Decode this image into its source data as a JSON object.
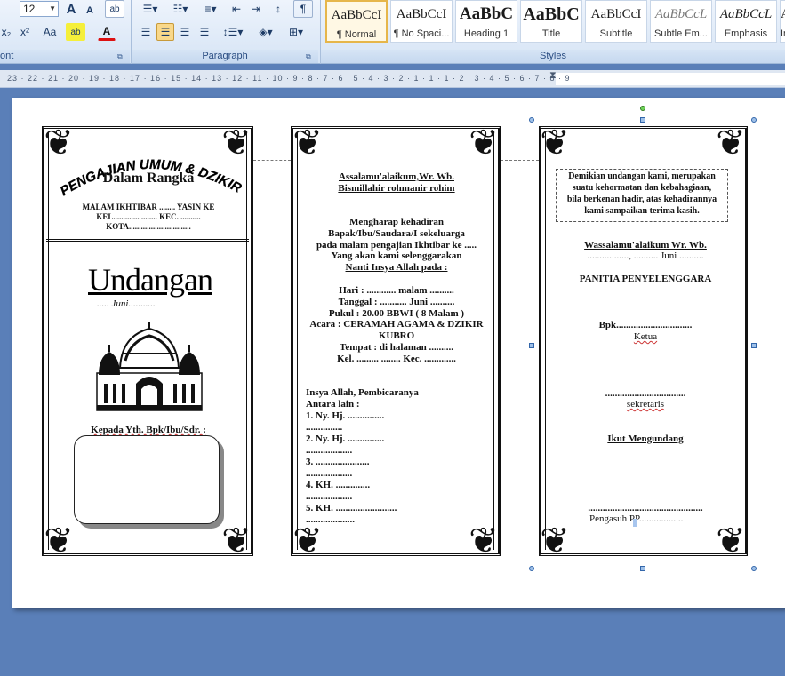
{
  "ribbon": {
    "font_size": "12",
    "font_group_label": "ont",
    "paragraph_group_label": "Paragraph",
    "styles_group_label": "Styles",
    "buttons": {
      "grow_font": "A",
      "shrink_font": "A",
      "clear_format": "ab",
      "subscript": "x₂",
      "superscript": "x²",
      "change_case": "Aa",
      "highlight": "ab",
      "font_color": "A"
    },
    "styles": [
      {
        "sample": "AaBbCcI",
        "name": "¶ Normal"
      },
      {
        "sample": "AaBbCcI",
        "name": "¶ No Spaci..."
      },
      {
        "sample": "AaBbC",
        "name": "Heading 1"
      },
      {
        "sample": "AaBbC",
        "name": "Title"
      },
      {
        "sample": "AaBbCcI",
        "name": "Subtitle"
      },
      {
        "sample": "AaBbCcL",
        "name": "Subtle Em..."
      },
      {
        "sample": "AaBbCcL",
        "name": "Emphasis"
      },
      {
        "sample": "A",
        "name": "In"
      }
    ]
  },
  "ruler": {
    "ticks": "23 · 22 · 21 · 20 · 19 · 18 · 17 · 16 · 15 · 14 · 13 · 12 · 11 · 10 · 9 · 8 · 7 · 6 · 5 · 4 · 3 · 2 · 1 · 1 · 1 · 2 · 3 · 4 · 5 · 6 · 7 · 8 · 9"
  },
  "panel1": {
    "arc_title": "PENGAJIAN UMUM & DZIKIR",
    "subtitle": "Dalam Rangka",
    "line1": "MALAM IKHTIBAR ........   YASIN KE",
    "line2": "KEL.............  ........  KEC. ..........",
    "line3": "KOTA...............................",
    "heading": "Undangan",
    "month_line": "..... Juni...........",
    "addressee": "Kepada Yth. Bpk/Ibu/Sdr. :"
  },
  "panel2": {
    "greeting1": "Assalamu'alaikum,Wr. Wb.",
    "greeting2": "Bismillahir rohmanir rohim",
    "body": [
      "Mengharap kehadiran",
      "Bapak/Ibu/Saudara/I sekeluarga",
      "pada malam pengajian Ikhtibar ke .....",
      "Yang akan kami selenggarakan",
      "Nanti Insya Allah pada :"
    ],
    "details": [
      "Hari : ............ malam ..........",
      "Tanggal : ........... Juni ..........",
      "Pukul : 20.00 BBWI ( 8 Malam )",
      "Acara : CERAMAH AGAMA & DZIKIR",
      "KUBRO",
      "Tempat : di halaman  ..........",
      "Kel. ......... ........ Kec. ............."
    ],
    "speakers_title": "Insya Allah, Pembicaranya",
    "speakers_sub": "Antara lain :",
    "speakers": [
      "1.   Ny. Hj. ...............",
      "   ...............",
      "2.   Ny. Hj. ...............",
      "   ...................",
      "3.   ......................",
      "   ...................",
      "4.   KH. ..............",
      "   ...................",
      "5.   KH. .........................",
      "   ...................."
    ]
  },
  "panel3": {
    "closing": [
      "Demikian undangan kami, merupakan",
      "suatu kehormatan dan kebahagiaan,",
      "bila berkenan hadir, atas kehadirannya",
      "kami sampaikan terima kasih."
    ],
    "farewell": "Wassalamu'alaikum Wr. Wb.",
    "date_line": "................., .......... Juni ..........",
    "committee": "PANITIA PENYELENGGARA",
    "chair_name": "Bpk...............................",
    "chair_role": "Ketua",
    "sec_line": ".................................",
    "sec_role": "sekretaris",
    "invite_title": "Ikut Mengundang",
    "patron_line": "...............................................",
    "patron_role": "Pengasuh PP.................."
  }
}
